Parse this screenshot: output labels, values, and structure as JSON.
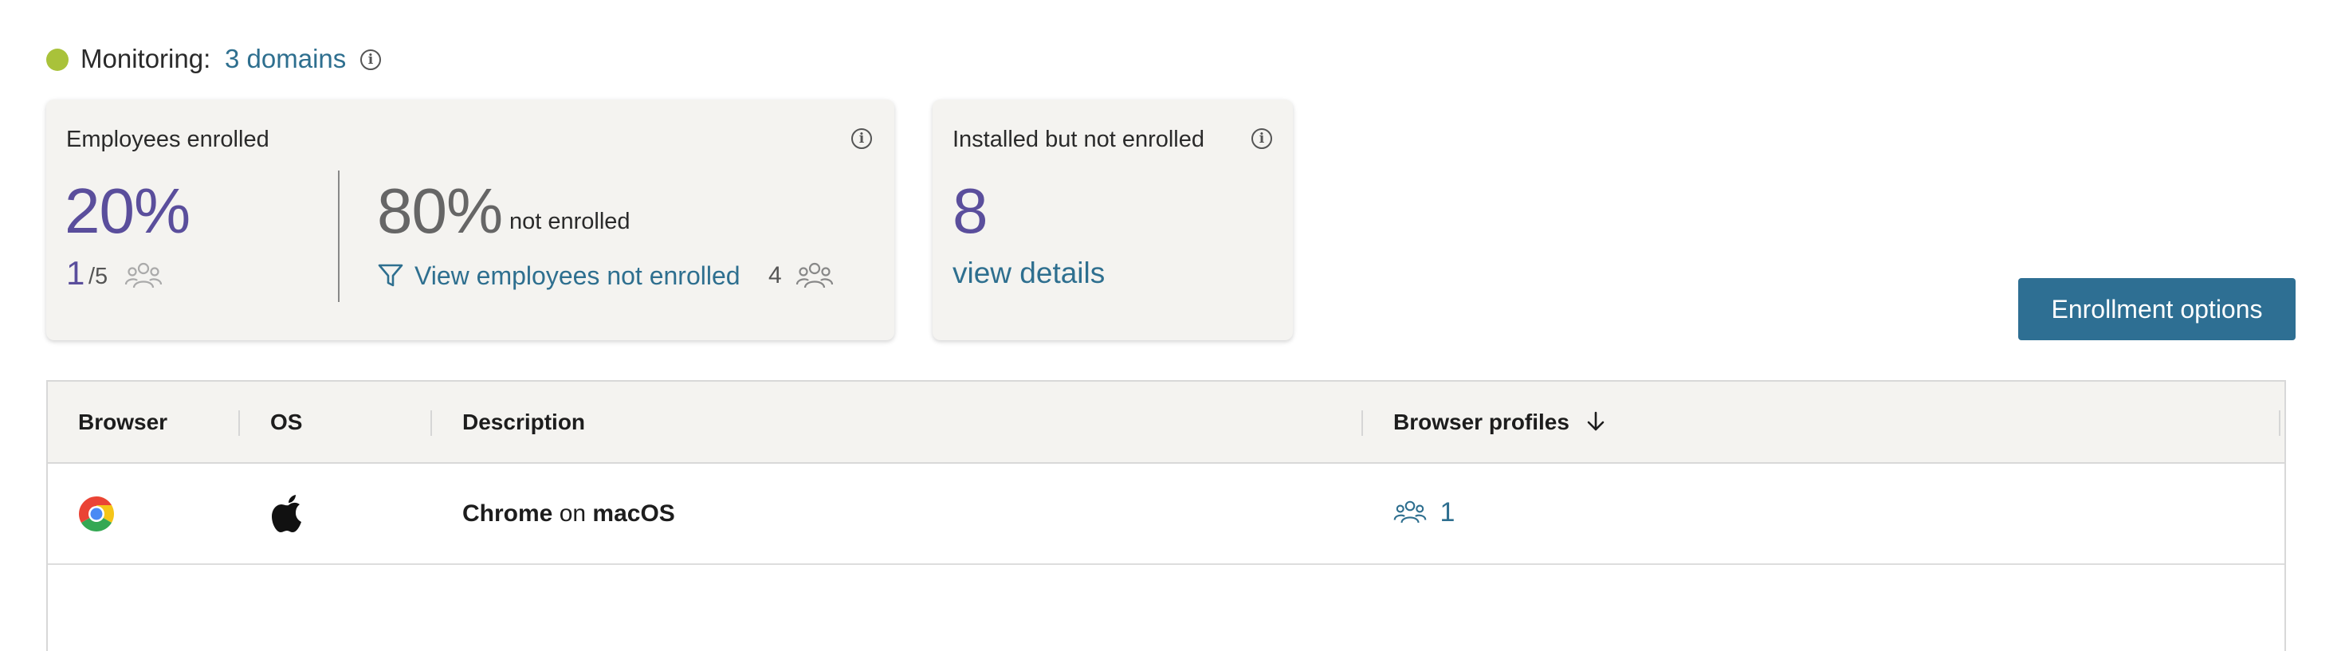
{
  "monitoring": {
    "label": "Monitoring:",
    "domains_link": "3 domains",
    "status_color": "#a9c23a"
  },
  "enrolled_card": {
    "title": "Employees enrolled",
    "enrolled_percent": "20%",
    "enrolled_count": "1",
    "total": "/5",
    "not_enrolled_percent": "80%",
    "not_enrolled_suffix": "not enrolled",
    "view_link": "View employees not enrolled",
    "not_enrolled_count": "4"
  },
  "installed_card": {
    "title": "Installed but not enrolled",
    "count": "8",
    "link": "view details"
  },
  "enrollment_button": "Enrollment options",
  "table": {
    "headers": {
      "browser": "Browser",
      "os": "OS",
      "description": "Description",
      "profiles": "Browser profiles"
    },
    "rows": [
      {
        "browser_icon": "chrome-icon",
        "os_icon": "apple-icon",
        "browser_name": "Chrome",
        "on": "on",
        "os_name": "macOS",
        "profiles_count": "1"
      }
    ]
  },
  "colors": {
    "accent_link": "#2e6f8f",
    "purple": "#5a4e9c",
    "button": "#2e6f93",
    "card_bg": "#f4f3f0"
  }
}
